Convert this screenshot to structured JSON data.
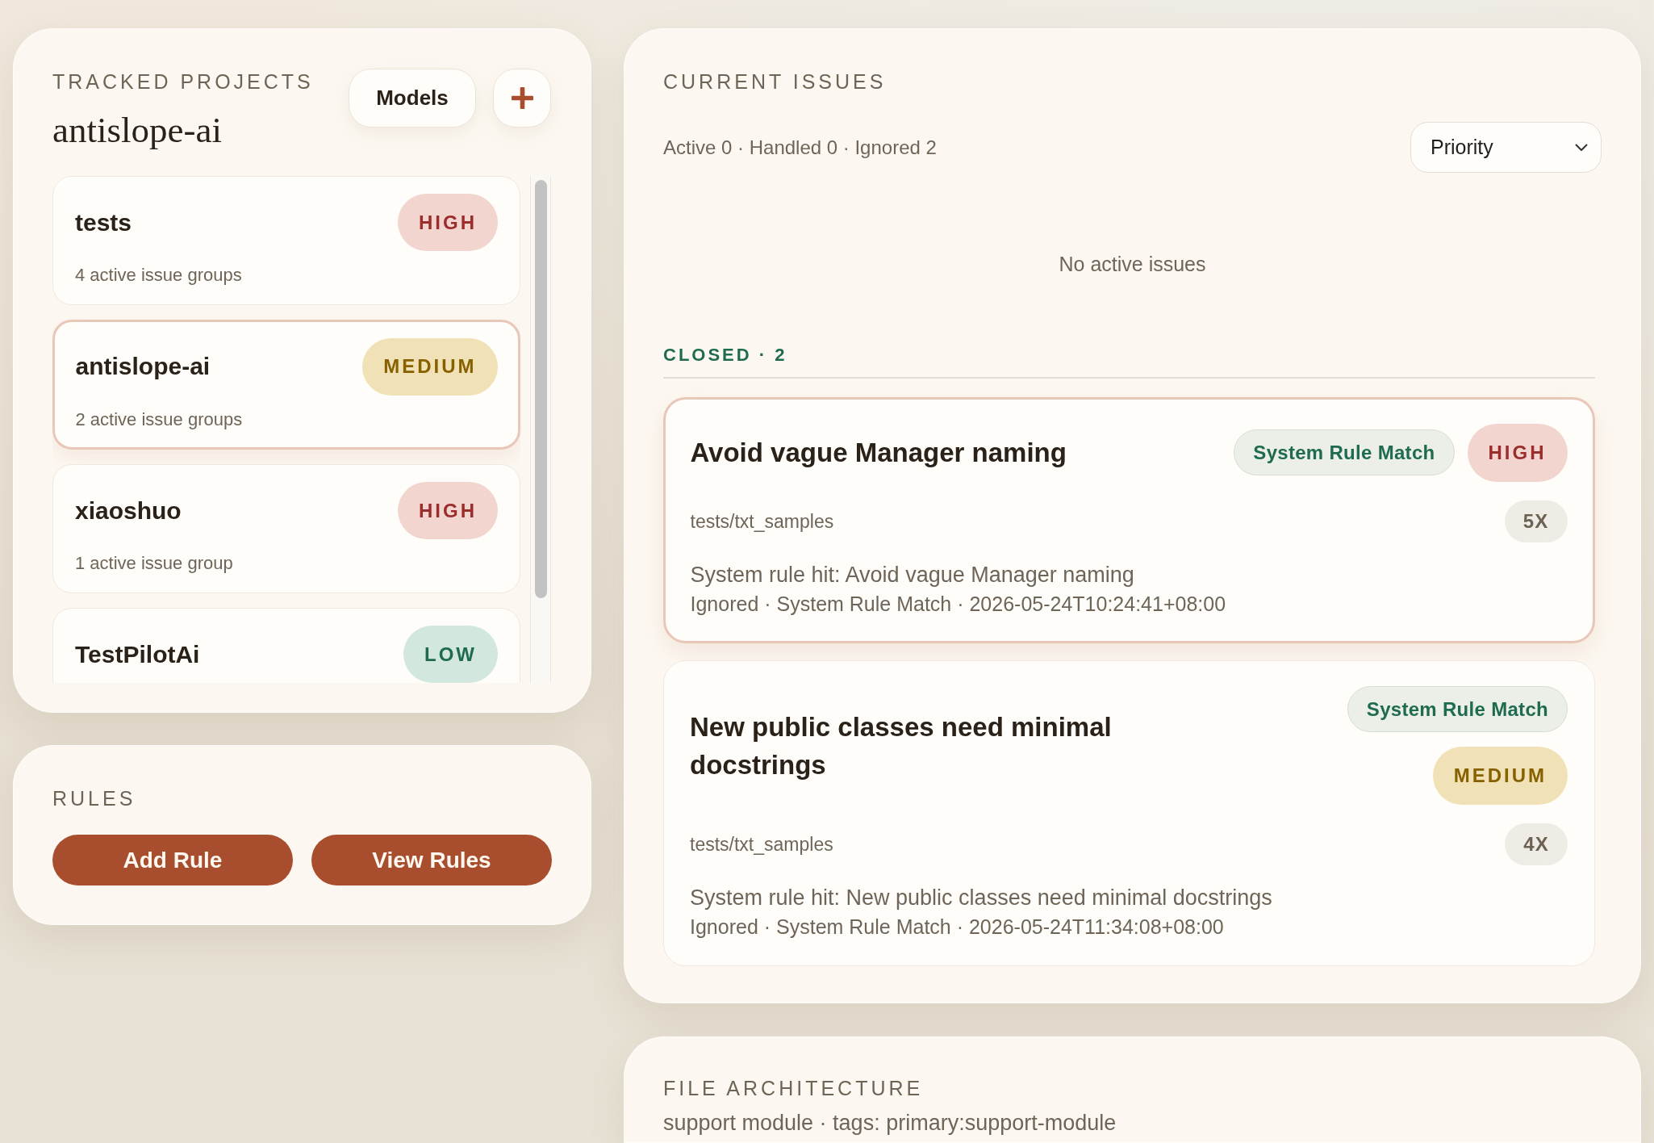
{
  "projects": {
    "title": "TRACKED PROJECTS",
    "current": "antislope-ai",
    "models_button": "Models",
    "items": [
      {
        "name": "tests",
        "summary": "4 active issue groups",
        "priority": {
          "label": "HIGH",
          "kind": "high"
        },
        "selected": false
      },
      {
        "name": "antislope-ai",
        "summary": "2 active issue groups",
        "priority": {
          "label": "MEDIUM",
          "kind": "medium"
        },
        "selected": true
      },
      {
        "name": "xiaoshuo",
        "summary": "1 active issue group",
        "priority": {
          "label": "HIGH",
          "kind": "high"
        },
        "selected": false
      },
      {
        "name": "TestPilotAi",
        "priority": {
          "label": "LOW",
          "kind": "low"
        },
        "selected": false
      }
    ]
  },
  "rules": {
    "title": "RULES",
    "buttons": [
      "Add Rule",
      "View Rules"
    ]
  },
  "issues": {
    "title": "CURRENT ISSUES",
    "stats": "Active 0 · Handled 0 · Ignored 2",
    "sort": {
      "value": "Priority"
    },
    "empty_message": "No active issues",
    "closed_heading": "CLOSED · 2",
    "closed": [
      {
        "title": "Avoid vague Manager naming",
        "tag": "System Rule Match",
        "priority": {
          "label": "HIGH",
          "kind": "high"
        },
        "path": "tests/txt_samples",
        "count": "5X",
        "description": "System rule hit: Avoid vague Manager naming",
        "meta": "Ignored · System Rule Match · 2026-05-24T10:24:41+08:00",
        "selected": true
      },
      {
        "title": "New public classes need minimal docstrings",
        "tag": "System Rule Match",
        "priority": {
          "label": "MEDIUM",
          "kind": "medium"
        },
        "path": "tests/txt_samples",
        "count": "4X",
        "description": "System rule hit: New public classes need minimal docstrings",
        "meta": "Ignored · System Rule Match · 2026-05-24T11:34:08+08:00",
        "selected": false
      }
    ]
  },
  "file_architecture": {
    "title": "FILE ARCHITECTURE",
    "lines": [
      "support module · tags: primary:support-module"
    ]
  }
}
